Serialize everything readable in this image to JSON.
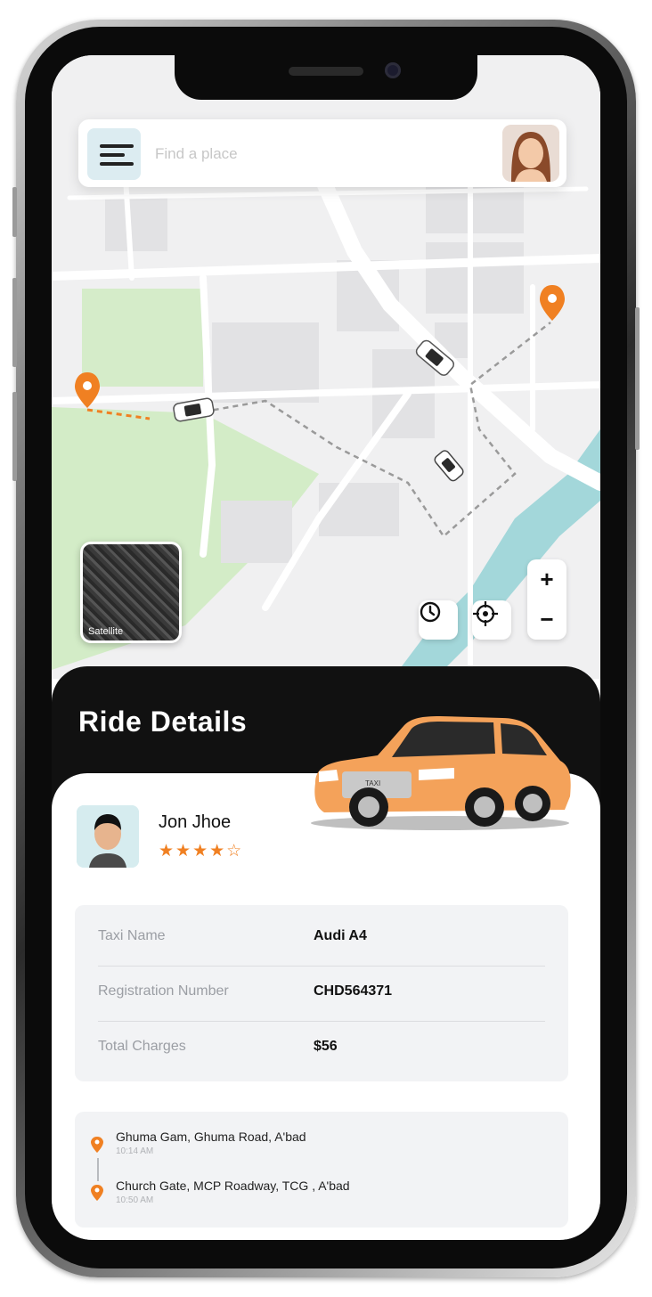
{
  "search": {
    "placeholder": "Find a place"
  },
  "map": {
    "satellite_label": "Satellite",
    "zoom_in": "+",
    "zoom_out": "−",
    "colors": {
      "pin": "#f08022",
      "park": "#cfe8c4",
      "river": "#9fd4d8",
      "route": "#9a9a9a"
    }
  },
  "ride": {
    "title": "Ride Details",
    "driver": {
      "name": "Jon Jhoe",
      "rating": 4,
      "stars": "★★★★☆"
    },
    "details": [
      {
        "label": "Taxi Name",
        "value": "Audi A4"
      },
      {
        "label": "Registration Number",
        "value": "CHD564371"
      },
      {
        "label": "Total Charges",
        "value": "$56"
      }
    ],
    "route": {
      "pickup": {
        "address": "Ghuma Gam, Ghuma Road, A'bad",
        "time": "10:14 AM"
      },
      "drop": {
        "address": "Church Gate, MCP Roadway, TCG , A'bad",
        "time": "10:50 AM"
      }
    },
    "car_badge": "TAXI"
  }
}
